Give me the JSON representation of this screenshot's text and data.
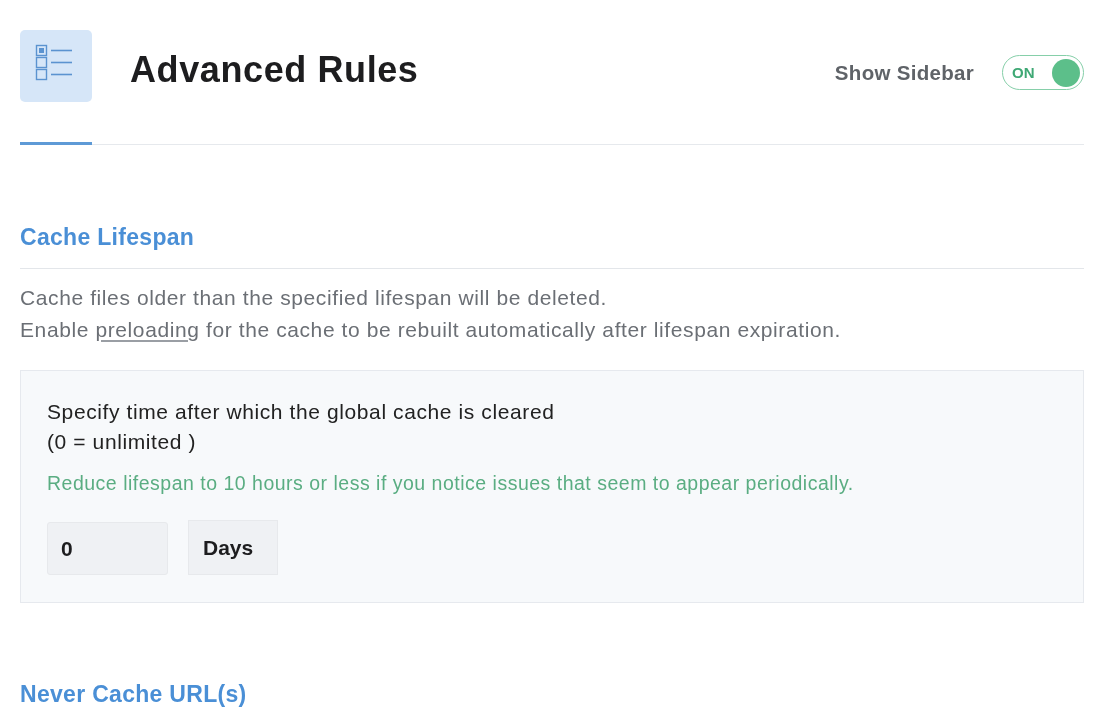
{
  "tabs": [
    {
      "selected": true
    }
  ],
  "header": {
    "title": "Advanced Rules",
    "sidebar_toggle": {
      "label": "Show Sidebar",
      "state_text": "ON",
      "on": true
    }
  },
  "sections": [
    {
      "title": "Cache Lifespan",
      "description": [
        [
          {
            "kind": "text",
            "text": "Cache files older than the specified lifespan will be deleted."
          }
        ],
        [
          {
            "kind": "text",
            "text": "Enable "
          },
          {
            "kind": "link",
            "text": "preloading"
          },
          {
            "kind": "text",
            "text": " for the cache to be rebuilt automatically after lifespan expiration."
          }
        ]
      ],
      "setting": {
        "label": "Specify time after which the global cache is cleared",
        "note": "(0 = unlimited )",
        "hint": "Reduce lifespan to 10 hours or less if you notice issues that seem to appear periodically.",
        "value": "0",
        "unit": "Days"
      }
    },
    {
      "title": "Never Cache URL(s)"
    }
  ]
}
